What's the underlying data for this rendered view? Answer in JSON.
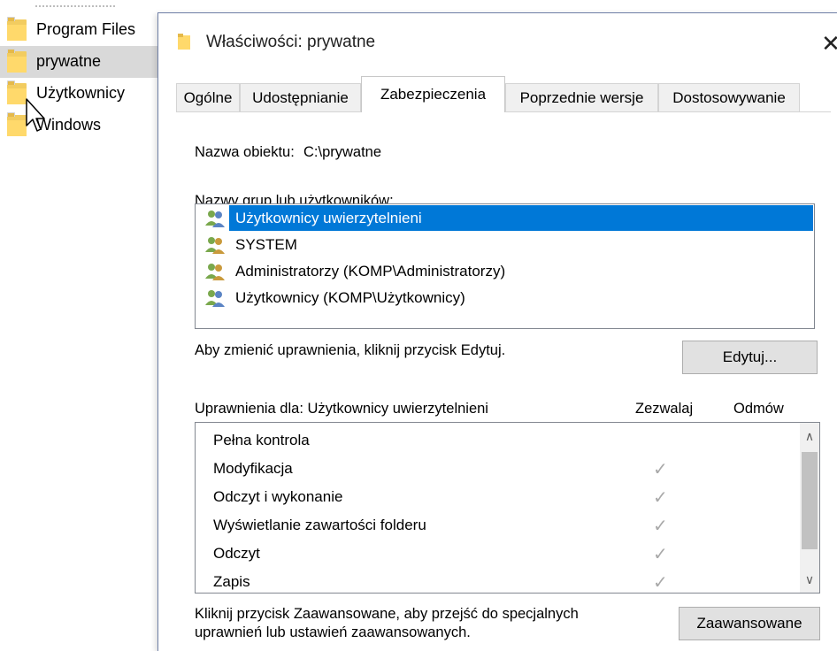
{
  "explorer": {
    "items": [
      {
        "label": "Program Files",
        "selected": false
      },
      {
        "label": "prywatne",
        "selected": true
      },
      {
        "label": "Użytkownicy",
        "selected": false
      },
      {
        "label": "Windows",
        "selected": false
      }
    ]
  },
  "dialog": {
    "title": "Właściwości: prywatne",
    "close_glyph": "✕",
    "tabs": [
      {
        "label": "Ogólne",
        "active": false
      },
      {
        "label": "Udostępnianie",
        "active": false
      },
      {
        "label": "Zabezpieczenia",
        "active": true
      },
      {
        "label": "Poprzednie wersje",
        "active": false
      },
      {
        "label": "Dostosowywanie",
        "active": false
      }
    ],
    "object_name_label": "Nazwa obiektu:",
    "object_name_value": "C:\\prywatne",
    "groups_label": "Nazwy grup lub użytkowników:",
    "groups": [
      {
        "label": "Użytkownicy uwierzytelnieni",
        "selected": true,
        "icon": "users-icon"
      },
      {
        "label": "SYSTEM",
        "selected": false,
        "icon": "users-icon"
      },
      {
        "label": "Administratorzy (KOMP\\Administratorzy)",
        "selected": false,
        "icon": "users-icon"
      },
      {
        "label": "Użytkownicy (KOMP\\Użytkownicy)",
        "selected": false,
        "icon": "users-icon"
      }
    ],
    "edit_hint": "Aby zmienić uprawnienia, kliknij przycisk Edytuj.",
    "edit_button": "Edytuj...",
    "permissions_for": "Uprawnienia dla: Użytkownicy uwierzytelnieni",
    "allow_header": "Zezwalaj",
    "deny_header": "Odmów",
    "permissions": [
      {
        "label": "Pełna kontrola",
        "allow": false
      },
      {
        "label": "Modyfikacja",
        "allow": true
      },
      {
        "label": "Odczyt i wykonanie",
        "allow": true
      },
      {
        "label": "Wyświetlanie zawartości folderu",
        "allow": true
      },
      {
        "label": "Odczyt",
        "allow": true
      },
      {
        "label": "Zapis",
        "allow": true
      }
    ],
    "check_glyph": "✓",
    "advanced_hint_line1": "Kliknij przycisk Zaawansowane, aby przejść do specjalnych",
    "advanced_hint_line2": "uprawnień lub ustawień zaawansowanych.",
    "advanced_button": "Zaawansowane",
    "scroll_up_glyph": "∧",
    "scroll_down_glyph": "∨",
    "colors": {
      "selection": "#0078d7",
      "folder": "#ffd96b",
      "check": "#a9a9a9"
    }
  }
}
